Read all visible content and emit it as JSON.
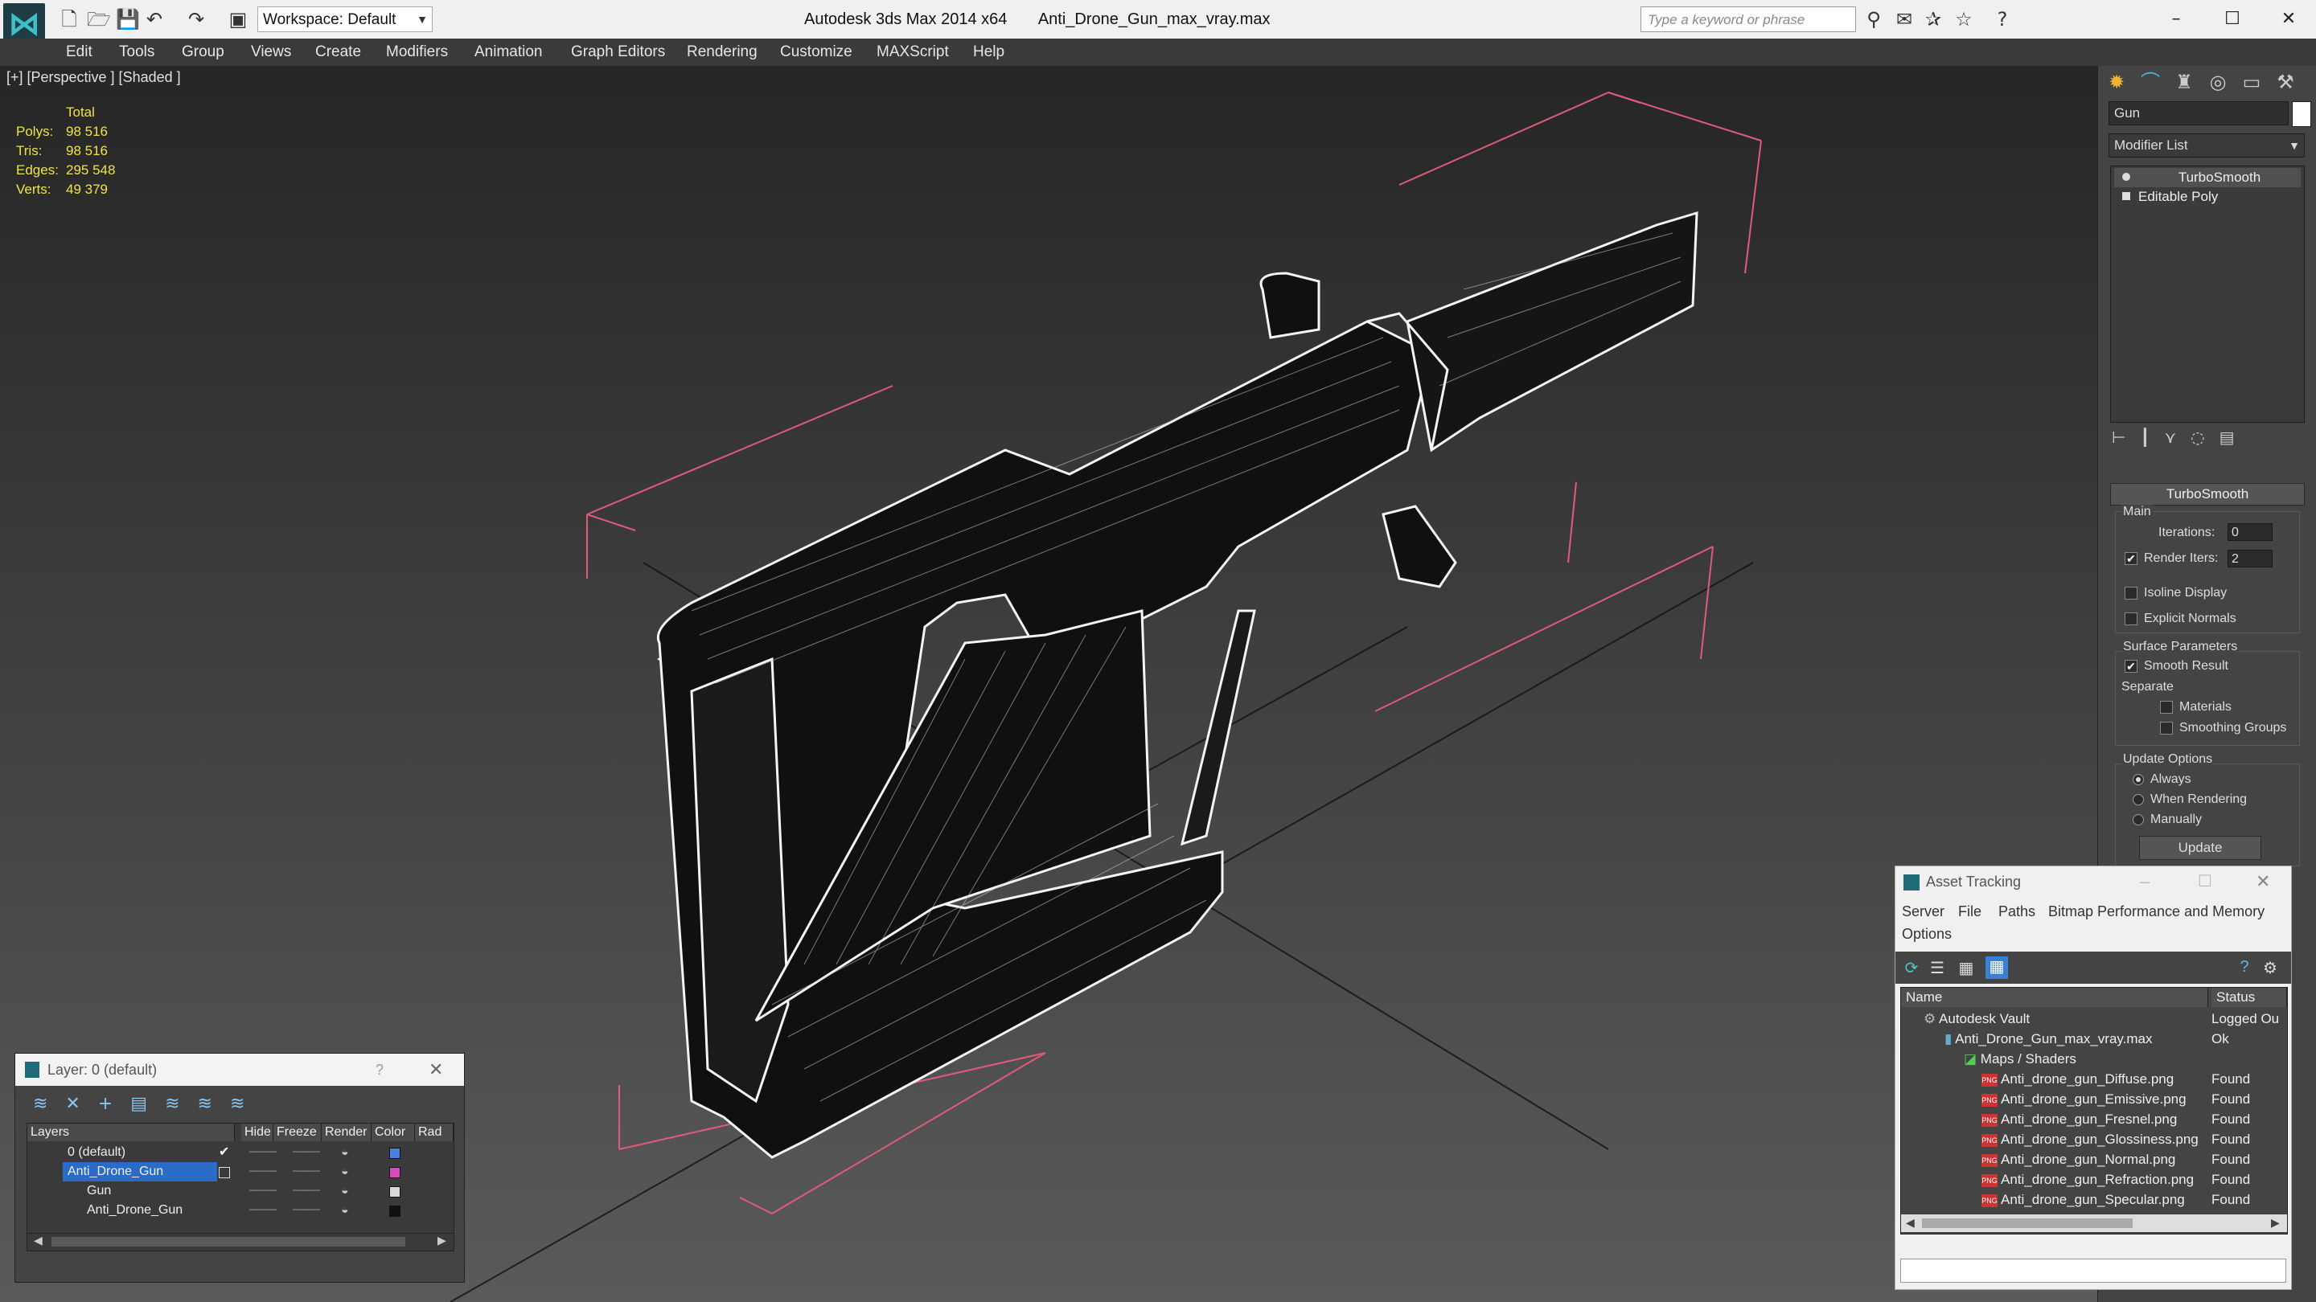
{
  "titlebar": {
    "workspace": "Workspace: Default",
    "app_title": "Autodesk 3ds Max  2014 x64",
    "file_name": "Anti_Drone_Gun_max_vray.max",
    "search_placeholder": "Type a keyword or phrase"
  },
  "menu": [
    "Edit",
    "Tools",
    "Group",
    "Views",
    "Create",
    "Modifiers",
    "Animation",
    "Graph Editors",
    "Rendering",
    "Customize",
    "MAXScript",
    "Help"
  ],
  "viewport": {
    "label": "[+] [Perspective ] [Shaded ]",
    "stats": {
      "header": "Total",
      "rows": [
        {
          "k": "Polys:",
          "v": "98 516"
        },
        {
          "k": "Tris:",
          "v": "98 516"
        },
        {
          "k": "Edges:",
          "v": "295 548"
        },
        {
          "k": "Verts:",
          "v": "49 379"
        }
      ]
    }
  },
  "command_panel": {
    "object_name": "Gun",
    "modifier_list": "Modifier List",
    "stack": [
      "TurboSmooth",
      "Editable Poly"
    ],
    "turbosmooth": {
      "title": "TurboSmooth",
      "main": "Main",
      "iterations_label": "Iterations:",
      "iterations_value": "0",
      "render_iters_label": "Render Iters:",
      "render_iters_value": "2",
      "isoline": "Isoline Display",
      "explicit_normals": "Explicit Normals",
      "surface_params": "Surface Parameters",
      "smooth_result": "Smooth Result",
      "separate": "Separate",
      "materials": "Materials",
      "smoothing_groups": "Smoothing Groups",
      "update_options": "Update Options",
      "always": "Always",
      "when_rendering": "When Rendering",
      "manually": "Manually",
      "update_button": "Update"
    }
  },
  "layer_dialog": {
    "title": "Layer: 0 (default)",
    "help": "?",
    "columns": [
      "Layers",
      "Hide",
      "Freeze",
      "Render",
      "Color",
      "Rad"
    ],
    "rows": [
      {
        "name": "0 (default)",
        "color": "#4a7fe0"
      },
      {
        "name": "Anti_Drone_Gun",
        "color": "#d84ab8"
      },
      {
        "name": "Gun",
        "color": "#d8d8d8"
      },
      {
        "name": "Anti_Drone_Gun",
        "color": "#111111"
      }
    ]
  },
  "asset_dialog": {
    "title": "Asset Tracking",
    "menu": [
      "Server",
      "File",
      "Paths",
      "Bitmap Performance and Memory",
      "Options"
    ],
    "columns": [
      "Name",
      "Status"
    ],
    "rows": [
      {
        "name": "Autodesk Vault",
        "status": "Logged Ou"
      },
      {
        "name": "Anti_Drone_Gun_max_vray.max",
        "status": "Ok"
      },
      {
        "name": "Maps / Shaders",
        "status": ""
      },
      {
        "name": "Anti_drone_gun_Diffuse.png",
        "status": "Found"
      },
      {
        "name": "Anti_drone_gun_Emissive.png",
        "status": "Found"
      },
      {
        "name": "Anti_drone_gun_Fresnel.png",
        "status": "Found"
      },
      {
        "name": "Anti_drone_gun_Glossiness.png",
        "status": "Found"
      },
      {
        "name": "Anti_drone_gun_Normal.png",
        "status": "Found"
      },
      {
        "name": "Anti_drone_gun_Refraction.png",
        "status": "Found"
      },
      {
        "name": "Anti_drone_gun_Specular.png",
        "status": "Found"
      }
    ]
  }
}
